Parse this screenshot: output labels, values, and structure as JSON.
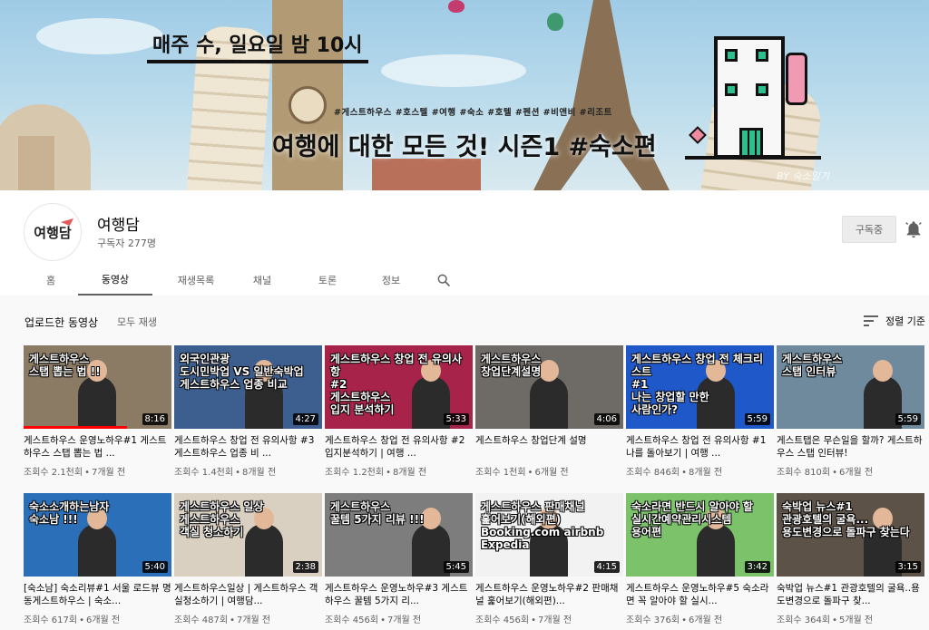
{
  "banner": {
    "schedule": "매주 수, 일요일 밤 10시",
    "hashtags": "#게스트하우스 #호스텔 #여행 #숙소 #호텔 #펜션 #비앤비 #리조트",
    "headline": "여행에 대한 모든 것!  시즌1 #숙소편",
    "credit": "BY 숙소일기"
  },
  "channel": {
    "avatar_text": "여행담",
    "name": "여행담",
    "subscribers": "구독자 277명",
    "subscribe_label": "구독중"
  },
  "tabs": [
    {
      "label": "홈",
      "width": 60
    },
    {
      "label": "동영상",
      "width": 82,
      "active": true
    },
    {
      "label": "재생목록",
      "width": 96
    },
    {
      "label": "채널",
      "width": 50
    },
    {
      "label": "토론",
      "width": 94
    },
    {
      "label": "정보",
      "width": 46
    }
  ],
  "section": {
    "title": "업로드한 동영상",
    "play_all": "모두 재생",
    "sort_label": "정렬 기준"
  },
  "videos": [
    {
      "title": "게스트하우스 운영노하우#1 게스트하우스 스탭 뽑는 법 ...",
      "views": "조회수 2.1천회",
      "age": "7개월 전",
      "duration": "8:16",
      "thumb_text": "게스트하우스\n스탭 뽑는 법 !!",
      "bg": "#8b7a64",
      "progress": 70
    },
    {
      "title": "게스트하우스 창업 전 유의사항 #3 게스트하우스 업종 비 ...",
      "views": "조회수 1.4천회",
      "age": "8개월 전",
      "duration": "4:27",
      "thumb_text": "외국인관광\n도시민박업  VS  일반숙박업\n게스트하우스 업종 비교",
      "bg": "#3d5f8f",
      "progress": 0
    },
    {
      "title": "게스트하우스 창업 전 유의사항 #2 입지분석하기 | 여행 ...",
      "views": "조회수 1.2천회",
      "age": "8개월 전",
      "duration": "5:33",
      "thumb_text": "게스트하우스 창업 전 유의사항\n#2\n게스트하우스\n입지 분석하기",
      "bg": "#a8234a",
      "progress": 0
    },
    {
      "title": "게스트하우스 창업단계 설명",
      "views": "조회수 1천회",
      "age": "6개월 전",
      "duration": "4:06",
      "thumb_text": "게스트하우스\n창업단계설명",
      "bg": "#6e6a66",
      "progress": 0
    },
    {
      "title": "게스트하우스 창업 전 유의사항 #1 나를 돌아보기 | 여행 ...",
      "views": "조회수 846회",
      "age": "8개월 전",
      "duration": "5:59",
      "thumb_text": "게스트하우스 창업 전 체크리스트\n#1\n나는 창업할 만한\n사람인가?",
      "bg": "#1f58c8",
      "progress": 0
    },
    {
      "title": "게스트탭은 무슨일을 할까? 게스트하우스 스탭 인터뷰!",
      "views": "조회수 810회",
      "age": "6개월 전",
      "duration": "5:59",
      "thumb_text": "게스트하우스\n스탭 인터뷰",
      "bg": "#6f8a9c",
      "progress": 0
    },
    {
      "title": "[숙소남] 숙소리뷰#1 서울 로드뷰 명동게스트하우스 | 숙소...",
      "views": "조회수 617회",
      "age": "6개월 전",
      "duration": "5:40",
      "thumb_text": "숙소소개하는남자\n숙소남 !!!",
      "bg": "#2a6fb8",
      "progress": 0
    },
    {
      "title": "게스트하우스일상 | 게스트하우스 객실청소하기 | 여행담...",
      "views": "조회수 487회",
      "age": "7개월 전",
      "duration": "2:38",
      "thumb_text": "게스트하우스 일상\n게스트하우스\n객실 청소하기",
      "bg": "#d9d0c2",
      "progress": 0
    },
    {
      "title": "게스트하우스 운영노하우#3 게스트하우스 꿀템 5가지 리...",
      "views": "조회수 456회",
      "age": "7개월 전",
      "duration": "5:45",
      "thumb_text": "게스트하우스\n꿀템 5가지 리뷰 !!!",
      "bg": "#7d7d7d",
      "progress": 0
    },
    {
      "title": "게스트하우스 운영노하우#2 판매채널 훑어보기(해외편)...",
      "views": "조회수 456회",
      "age": "7개월 전",
      "duration": "4:15",
      "thumb_text": "게스트하우스 판매채널\n훑어보기(해외편)\nBooking.com  airbnb  Expedia",
      "bg": "#f2f2f2",
      "progress": 0
    },
    {
      "title": "게스트하우스 운영노하우#5 숙소라면 꼭 알아야 할 실시...",
      "views": "조회수 376회",
      "age": "6개월 전",
      "duration": "3:42",
      "thumb_text": "숙소라면 반드시 알아야 할\n실시간예약관리시스템\n용어편",
      "bg": "#7bc26a",
      "progress": 0
    },
    {
      "title": "숙박업 뉴스#1 관광호텔의 굴욕..용도변경으로 돌파구 찾...",
      "views": "조회수 364회",
      "age": "5개월 전",
      "duration": "3:15",
      "thumb_text": "숙박업 뉴스#1\n관광호텔의 굴욕...\n용도변경으로 돌파구 찾는다",
      "bg": "#5d5248",
      "progress": 0
    }
  ]
}
